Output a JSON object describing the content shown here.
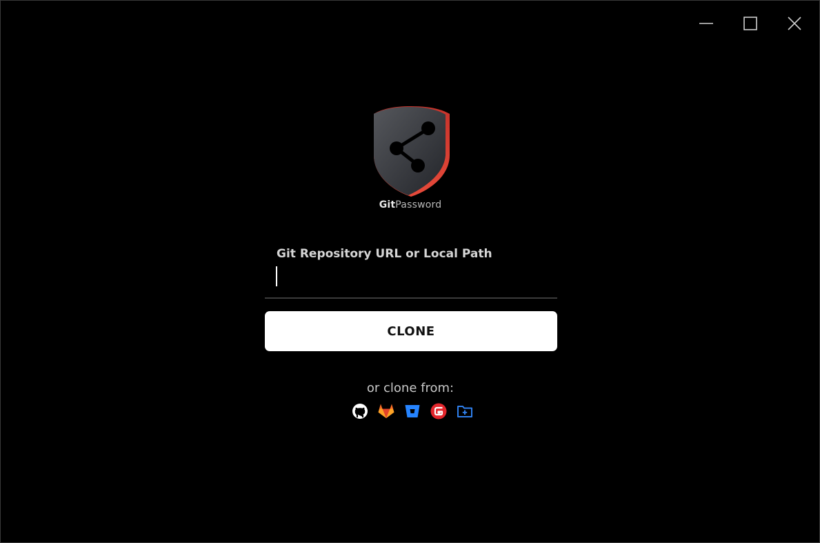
{
  "app": {
    "brand_part1": "Git",
    "brand_part2": "Password"
  },
  "form": {
    "label": "Git Repository URL or Local Path",
    "value": "",
    "placeholder": ""
  },
  "clone_button": {
    "label": "CLONE"
  },
  "alternatives": {
    "label": "or clone from:",
    "providers": [
      {
        "name": "github-icon",
        "color": "#ffffff"
      },
      {
        "name": "gitlab-icon",
        "color": "#fc6d26"
      },
      {
        "name": "bitbucket-icon",
        "color": "#2684ff"
      },
      {
        "name": "gitee-icon",
        "color": "#e3262c"
      },
      {
        "name": "local-folder-icon",
        "color": "#2f80ed"
      }
    ]
  },
  "colors": {
    "background": "#000000",
    "accent_red": "#d7392f",
    "button_bg": "#ffffff"
  }
}
